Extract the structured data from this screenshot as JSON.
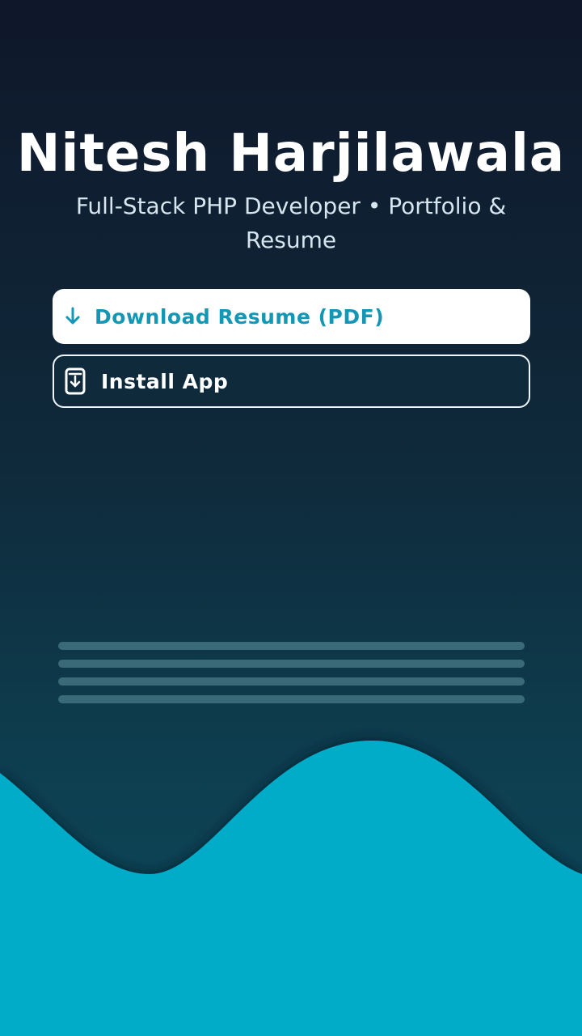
{
  "profile": {
    "name": "Nitesh Harjilawala",
    "subtitle": "Full-Stack PHP Developer • Portfolio & Resume"
  },
  "actions": {
    "download_label": "Download Resume (PDF)",
    "install_label": "Install App"
  },
  "icons": {
    "download": "arrow-down-icon",
    "install": "install-app-icon"
  },
  "colors": {
    "accent": "#00acc8",
    "primary_button_text": "#1496b5",
    "background_top": "#0f172a",
    "background_bottom": "#0b4a5a"
  }
}
